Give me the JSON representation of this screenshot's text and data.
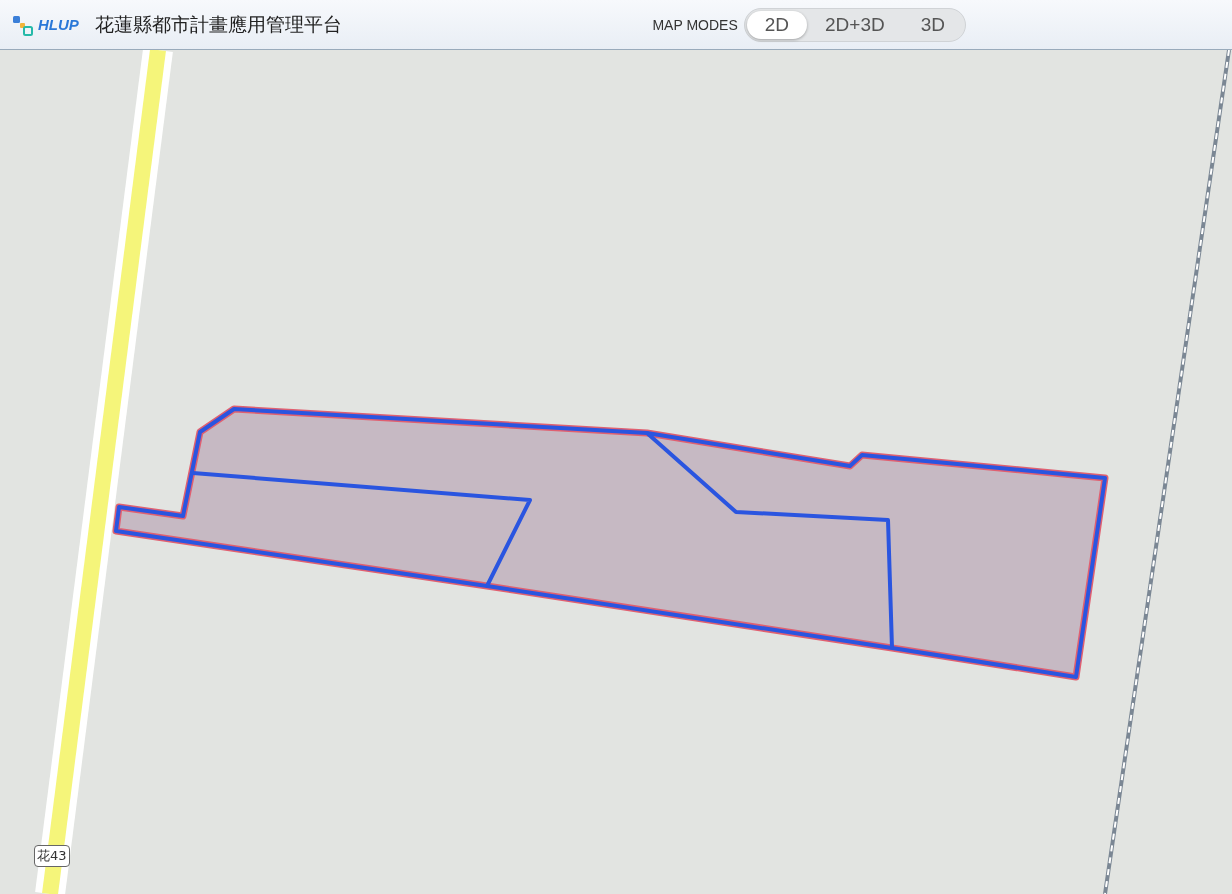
{
  "header": {
    "logo_text": "HLUP",
    "title": "花蓮縣都市計畫應用管理平台"
  },
  "map_modes": {
    "label": "MAP MODES",
    "options": [
      {
        "label": "2D",
        "selected": true
      },
      {
        "label": "2D+3D",
        "selected": false
      },
      {
        "label": "3D",
        "selected": false
      }
    ]
  },
  "map": {
    "road_label": "花43"
  }
}
